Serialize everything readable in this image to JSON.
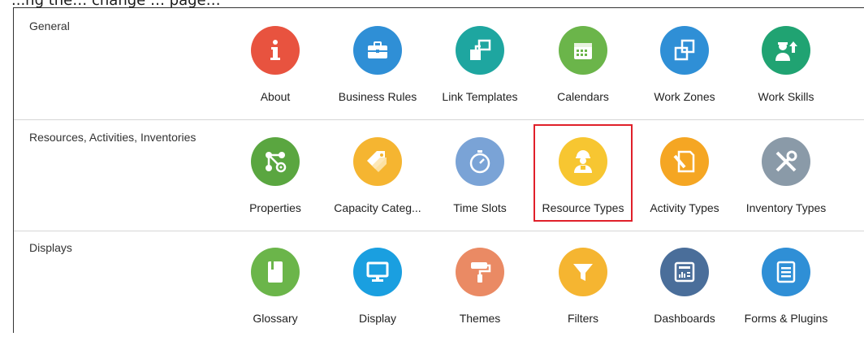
{
  "caption": "...ng the… change … page…",
  "sections": [
    {
      "label": "General",
      "tiles": [
        {
          "label": "About",
          "color": "#e8533f",
          "icon": "info-icon"
        },
        {
          "label": "Business Rules",
          "color": "#2f8fd6",
          "icon": "briefcase-icon"
        },
        {
          "label": "Link Templates",
          "color": "#1ea6a0",
          "icon": "link-squares-icon"
        },
        {
          "label": "Calendars",
          "color": "#6bb54a",
          "icon": "calendar-icon"
        },
        {
          "label": "Work Zones",
          "color": "#2f8fd6",
          "icon": "zones-icon"
        },
        {
          "label": "Work Skills",
          "color": "#20a372",
          "icon": "worker-up-icon"
        }
      ]
    },
    {
      "label": "Resources, Activities, Inventories",
      "tiles": [
        {
          "label": "Properties",
          "color": "#5aa640",
          "icon": "properties-icon"
        },
        {
          "label": "Capacity Categ...",
          "color": "#f5b531",
          "icon": "tags-icon"
        },
        {
          "label": "Time Slots",
          "color": "#7aa3d6",
          "icon": "stopwatch-icon"
        },
        {
          "label": "Resource Types",
          "color": "#f7c631",
          "icon": "resource-worker-icon",
          "highlighted": true
        },
        {
          "label": "Activity Types",
          "color": "#f5a623",
          "icon": "activity-icon"
        },
        {
          "label": "Inventory Types",
          "color": "#8a9aa8",
          "icon": "tools-icon"
        }
      ]
    },
    {
      "label": "Displays",
      "tiles": [
        {
          "label": "Glossary",
          "color": "#6bb54a",
          "icon": "book-icon"
        },
        {
          "label": "Display",
          "color": "#1a9fe0",
          "icon": "monitor-icon"
        },
        {
          "label": "Themes",
          "color": "#ea8a64",
          "icon": "paint-roller-icon"
        },
        {
          "label": "Filters",
          "color": "#f5b531",
          "icon": "filter-icon"
        },
        {
          "label": "Dashboards",
          "color": "#4a6e9a",
          "icon": "dashboard-icon"
        },
        {
          "label": "Forms & Plugins",
          "color": "#2f8fd6",
          "icon": "form-icon"
        }
      ]
    }
  ]
}
